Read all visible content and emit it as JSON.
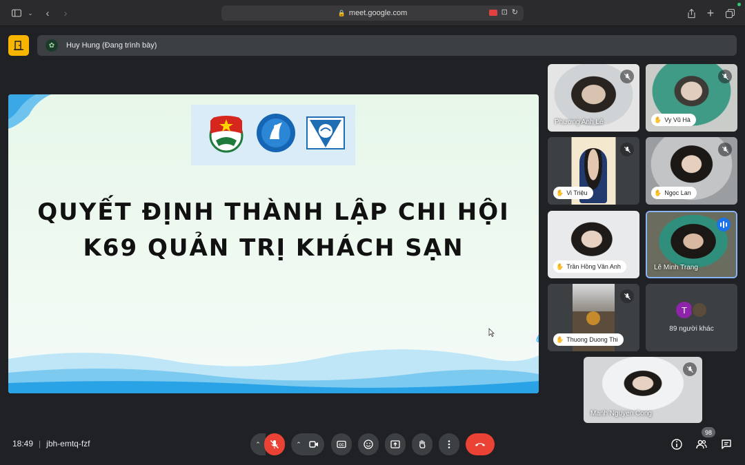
{
  "browser": {
    "url": "meet.google.com"
  },
  "presenter_bar": {
    "label": "Huy Hung (Đang trình bày)"
  },
  "slide": {
    "title_line1": "QUYẾT ĐỊNH THÀNH LẬP CHI HỘI",
    "title_line2": "K69 QUẢN TRỊ KHÁCH SẠN"
  },
  "participants": [
    {
      "name": "Phương Anh Lê",
      "muted": true,
      "style": "plain"
    },
    {
      "name": "Vy Vũ Hà",
      "muted": true,
      "style": "pill"
    },
    {
      "name": "Vi Triệu",
      "muted": true,
      "style": "pill"
    },
    {
      "name": "Ngọc Lan",
      "muted": true,
      "style": "pill"
    },
    {
      "name": "Trần Hồng Vân Anh",
      "muted": false,
      "style": "pill"
    },
    {
      "name": "Lê Minh Trang",
      "muted": false,
      "speaking": true,
      "style": "plain"
    },
    {
      "name": "Thuong Duong Thi",
      "muted": true,
      "style": "pill"
    },
    {
      "name": "Manh Nguyen Cong",
      "muted": true,
      "style": "plain"
    }
  ],
  "others": {
    "avatar_letter": "T",
    "label": "89 người khác"
  },
  "meeting": {
    "time": "18:49",
    "code": "jbh-emtq-fzf",
    "participant_count": "98"
  },
  "colors": {
    "end_call": "#ea4335",
    "active_border": "#8ab4f8",
    "speaking": "#1a73e8",
    "app_button": "#f7b500"
  }
}
